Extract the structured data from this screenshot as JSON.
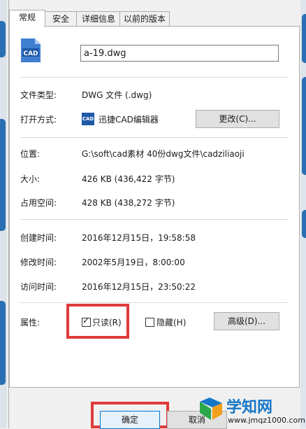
{
  "tabs": [
    {
      "label": "常规"
    },
    {
      "label": "安全"
    },
    {
      "label": "详细信息"
    },
    {
      "label": "以前的版本"
    }
  ],
  "file": {
    "icon": "cad-file-icon",
    "name": "a-19.dwg"
  },
  "type": {
    "label": "文件类型:",
    "value": "DWG 文件 (.dwg)"
  },
  "open_with": {
    "label": "打开方式:",
    "app_icon": "cad-app-icon",
    "app_icon_text": "CAD",
    "app_name": "迅捷CAD编辑器",
    "change_button": "更改(C)..."
  },
  "location": {
    "label": "位置:",
    "value": "G:\\soft\\cad素材 40份dwg文件\\cadziliaoji"
  },
  "size": {
    "label": "大小:",
    "value": "426 KB (436,422 字节)"
  },
  "size_on_disk": {
    "label": "占用空间:",
    "value": "428 KB (438,272 字节)"
  },
  "created": {
    "label": "创建时间:",
    "value": "2016年12月15日，19:58:58"
  },
  "modified": {
    "label": "修改时间:",
    "value": "2002年5月19日，8:00:00"
  },
  "accessed": {
    "label": "访问时间:",
    "value": "2016年12月15日，23:50:22"
  },
  "attributes": {
    "label": "属性:",
    "readonly": {
      "label": "只读(R)",
      "checked": true
    },
    "hidden": {
      "label": "隐藏(H)",
      "checked": false
    },
    "advanced_button": "高级(D)..."
  },
  "footer": {
    "ok": "确定",
    "cancel": "取消"
  },
  "watermark": {
    "title": "学知网",
    "url": "www.jmqz1000.com"
  },
  "colors": {
    "highlight": "#e03a3a",
    "accent": "#1677c7"
  }
}
